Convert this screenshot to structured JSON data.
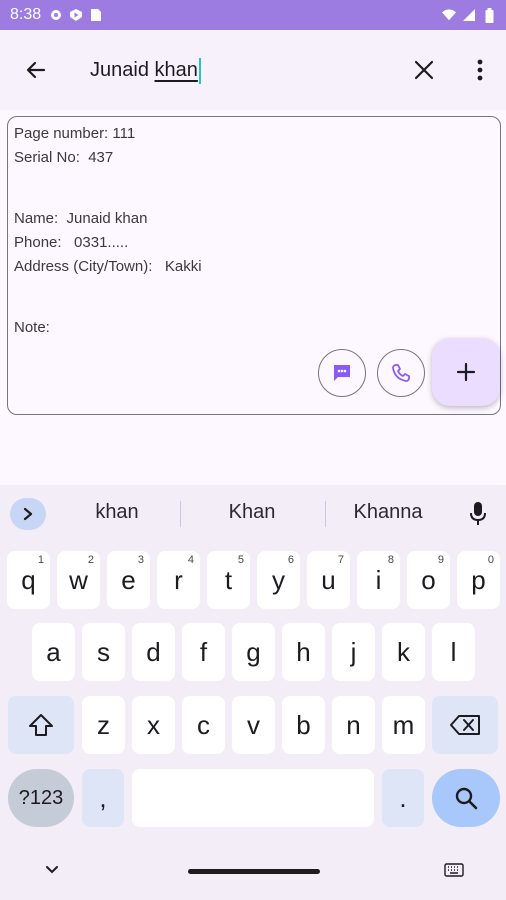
{
  "status_bar": {
    "time": "8:38",
    "bg_color": "#9c7ce0"
  },
  "search": {
    "query_part1": "Junaid ",
    "query_part2": "khan"
  },
  "card": {
    "page_number": "Page number: 111",
    "serial_no": "Serial No:  437",
    "name": "Name:  Junaid khan",
    "phone": "Phone:   0331.....",
    "address": "Address (City/Town):   Kakki",
    "note": "Note:"
  },
  "keyboard": {
    "suggestions": [
      "khan",
      "Khan",
      "Khanna"
    ],
    "row1": [
      {
        "k": "q",
        "h": "1"
      },
      {
        "k": "w",
        "h": "2"
      },
      {
        "k": "e",
        "h": "3"
      },
      {
        "k": "r",
        "h": "4"
      },
      {
        "k": "t",
        "h": "5"
      },
      {
        "k": "y",
        "h": "6"
      },
      {
        "k": "u",
        "h": "7"
      },
      {
        "k": "i",
        "h": "8"
      },
      {
        "k": "o",
        "h": "9"
      },
      {
        "k": "p",
        "h": "0"
      }
    ],
    "row2": [
      "a",
      "s",
      "d",
      "f",
      "g",
      "h",
      "j",
      "k",
      "l"
    ],
    "row3": [
      "z",
      "x",
      "c",
      "v",
      "b",
      "n",
      "m"
    ],
    "symbols_label": "?123",
    "comma": ",",
    "period": "."
  },
  "colors": {
    "accent": "#8a5cf5",
    "fab_bg": "#eaddff",
    "search_key": "#a8c7fa"
  }
}
